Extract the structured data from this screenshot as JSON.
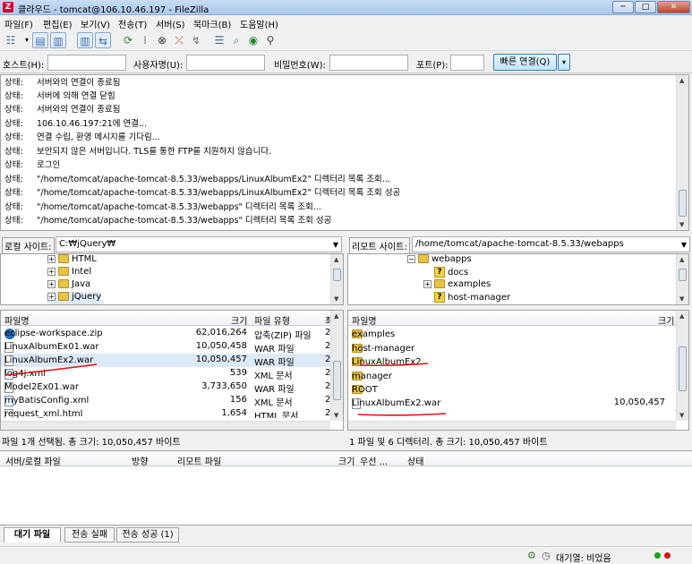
{
  "window": {
    "title": "클라우드 - tomcat@106.10.46.197 - FileZilla",
    "min_label": "─",
    "max_label": "□",
    "close_label": "✕"
  },
  "menu": [
    "파일(F)",
    "편집(E)",
    "보기(V)",
    "전송(T)",
    "서버(S)",
    "북마크(B)",
    "도움말(H)"
  ],
  "quickconnect": {
    "host_label": "호스트(H):",
    "host_value": "",
    "user_label": "사용자명(U):",
    "user_value": "",
    "pass_label": "비밀번호(W):",
    "pass_value": "",
    "port_label": "포트(P):",
    "port_value": "",
    "connect_button": "빠른 연결(Q)"
  },
  "log": [
    {
      "k": "상태:",
      "v": "서버와의 연결이 종료됨"
    },
    {
      "k": "상태:",
      "v": "서버에 의해 연결 닫힘"
    },
    {
      "k": "상태:",
      "v": "서버와의 연결이 종료됨"
    },
    {
      "k": "상태:",
      "v": "106.10.46.197:21에 연결..."
    },
    {
      "k": "상태:",
      "v": "연결 수립, 환영 메시지를 기다림..."
    },
    {
      "k": "상태:",
      "v": "보안되지 않은 서버입니다. TLS를 통한 FTP를 지원하지 않습니다."
    },
    {
      "k": "상태:",
      "v": "로그인"
    },
    {
      "k": "상태:",
      "v": "\"/home/tomcat/apache-tomcat-8.5.33/webapps/LinuxAlbumEx2\" 디렉터리 목록 조회..."
    },
    {
      "k": "상태:",
      "v": "\"/home/tomcat/apache-tomcat-8.5.33/webapps/LinuxAlbumEx2\" 디렉터리 목록 조회 성공"
    },
    {
      "k": "상태:",
      "v": "\"/home/tomcat/apache-tomcat-8.5.33/webapps\" 디렉터리 목록 조회..."
    },
    {
      "k": "상태:",
      "v": "\"/home/tomcat/apache-tomcat-8.5.33/webapps\" 디렉터리 목록 조회 성공"
    }
  ],
  "local": {
    "site_label": "로컬 사이트:",
    "path": "C:₩jQuery₩",
    "tree": [
      "HTML",
      "Intel",
      "Java",
      "jQuery"
    ],
    "headers": {
      "name": "파일명",
      "size": "크기",
      "type": "파일 유형",
      "mod": "최"
    },
    "files": [
      {
        "name": "eclipse-workspace.zip",
        "size": "62,016,264",
        "type": "압축(ZIP) 파일",
        "mod": "2",
        "icon": "zip-icon"
      },
      {
        "name": "LinuxAlbumEx01.war",
        "size": "10,050,458",
        "type": "WAR 파일",
        "mod": "2",
        "icon": "file-icon"
      },
      {
        "name": "LinuxAlbumEx2.war",
        "size": "10,050,457",
        "type": "WAR 파일",
        "mod": "2",
        "icon": "file-icon"
      },
      {
        "name": "log4j.xml",
        "size": "539",
        "type": "XML 문서",
        "mod": "2",
        "icon": "xml-icon"
      },
      {
        "name": "Model2Ex01.war",
        "size": "3,733,650",
        "type": "WAR 파일",
        "mod": "2",
        "icon": "file-icon"
      },
      {
        "name": "myBatisConfig.xml",
        "size": "156",
        "type": "XML 문서",
        "mod": "2",
        "icon": "xml-icon"
      },
      {
        "name": "request_xml.html",
        "size": "1,654",
        "type": "HTML 문서",
        "mod": "2",
        "icon": "file-icon"
      }
    ],
    "status": "파일 1개 선택됨. 총 크기: 10,050,457 바이트"
  },
  "remote": {
    "site_label": "리모트 사이트:",
    "path": "/home/tomcat/apache-tomcat-8.5.33/webapps",
    "tree": [
      "webapps",
      "docs",
      "examples",
      "host-manager"
    ],
    "headers": {
      "name": "파일명",
      "size": "크기"
    },
    "files": [
      {
        "name": "examples",
        "size": "",
        "icon": "folder-icon"
      },
      {
        "name": "host-manager",
        "size": "",
        "icon": "folder-icon"
      },
      {
        "name": "LinuxAlbumEx2",
        "size": "",
        "icon": "folder-icon"
      },
      {
        "name": "manager",
        "size": "",
        "icon": "folder-icon"
      },
      {
        "name": "ROOT",
        "size": "",
        "icon": "folder-icon"
      },
      {
        "name": "LinuxAlbumEx2.war",
        "size": "10,050,457",
        "icon": "file-icon"
      }
    ],
    "status": "1 파일 및 6 디렉터리. 총 크기: 10,050,457 바이트"
  },
  "queue": {
    "headers": {
      "server": "서버/로컬 파일",
      "dir": "방향",
      "remote": "리모트 파일",
      "size": "크기",
      "prio": "우선 ...",
      "state": "상태"
    }
  },
  "tabs": [
    "대기 파일",
    "전송 실패",
    "전송 성공 (1)"
  ],
  "bottom": {
    "queue_status": "대기열: 비었음"
  },
  "colors": {
    "annotation": "#e01010",
    "selection": "#dde9f8",
    "folder": "#e8c34a"
  }
}
